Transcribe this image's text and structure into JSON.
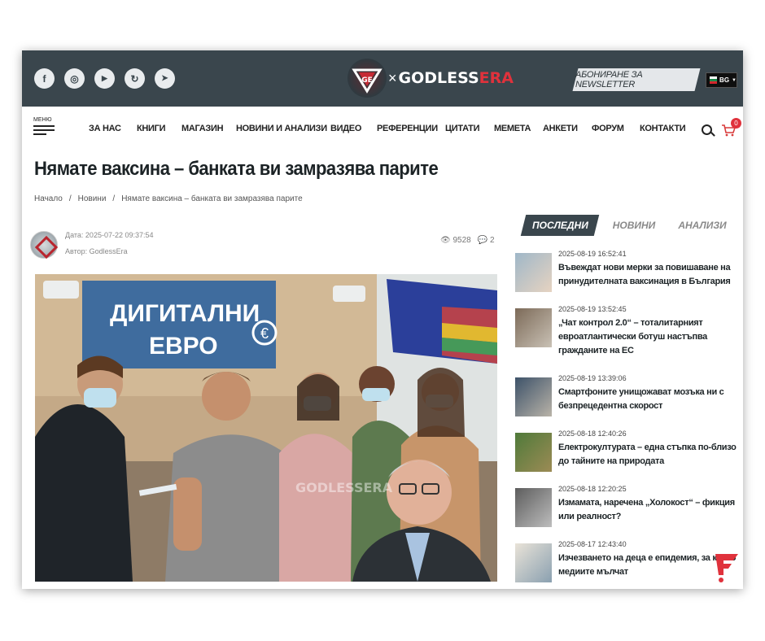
{
  "header": {
    "social": [
      {
        "icon": "facebook-icon",
        "glyph": "f"
      },
      {
        "icon": "instagram-icon",
        "glyph": "◎"
      },
      {
        "icon": "youtube-icon",
        "glyph": "▶"
      },
      {
        "icon": "refresh-icon",
        "glyph": "↻"
      },
      {
        "icon": "telegram-icon",
        "glyph": "➤"
      }
    ],
    "logo_prefix": "×",
    "logo_main": "GODLESS",
    "logo_accent": "ERA",
    "newsletter_label": "АБОНИРАНЕ ЗА NEWSLETTER",
    "language": "BG"
  },
  "nav": {
    "menu_label": "МЕНЮ",
    "items": [
      "ЗА НАС",
      "КНИГИ",
      "МАГАЗИН",
      "НОВИНИ И АНАЛИЗИ",
      "ВИДЕО",
      "РЕФЕРЕНЦИИ",
      "ЦИТАТИ",
      "МЕМЕТА",
      "АНКЕТИ",
      "ФОРУМ",
      "КОНТАКТИ"
    ],
    "cart_count": "0"
  },
  "article": {
    "title": "Нямате ваксина – банката ви замразява парите",
    "breadcrumb": [
      "Начало",
      "/",
      "Новини",
      "/",
      "Нямате ваксина – банката ви замразява парите"
    ],
    "date": "Дата: 2025-07-22 09:37:54",
    "author": "Автор: GodlessEra",
    "views": "9528",
    "comments": "2",
    "image": {
      "sign_line1": "ДИГИТАЛНИ",
      "sign_line2": "ЕВРО",
      "watermark": "GODLESSERA"
    }
  },
  "sidebar": {
    "tabs": [
      "ПОСЛЕДНИ",
      "НОВИНИ",
      "АНАЛИЗИ"
    ],
    "active_tab": "ПОСЛЕДНИ",
    "items": [
      {
        "time": "2025-08-19 16:52:41",
        "title": "Въвеждат нови мерки за повишаване на принудителната ваксинация в България"
      },
      {
        "time": "2025-08-19 13:52:45",
        "title": "„Чат контрол 2.0“ – тоталитарният евроатлантически ботуш настъпва гражданите на ЕС"
      },
      {
        "time": "2025-08-19 13:39:06",
        "title": "Смартфоните унищожават мозъка ни с безпрецедентна скорост"
      },
      {
        "time": "2025-08-18 12:40:26",
        "title": "Електрокултурата – една стъпка по-близо до тайните на природата"
      },
      {
        "time": "2025-08-18 12:20:25",
        "title": "Измамата, наречена „Холокост“ – фикция или реалност?"
      },
      {
        "time": "2025-08-17 12:43:40",
        "title": "Изчезването на деца е епидемия, за която медиите мълчат"
      }
    ]
  },
  "colors": {
    "topbar": "#3a464d",
    "accent": "#e0323c"
  }
}
